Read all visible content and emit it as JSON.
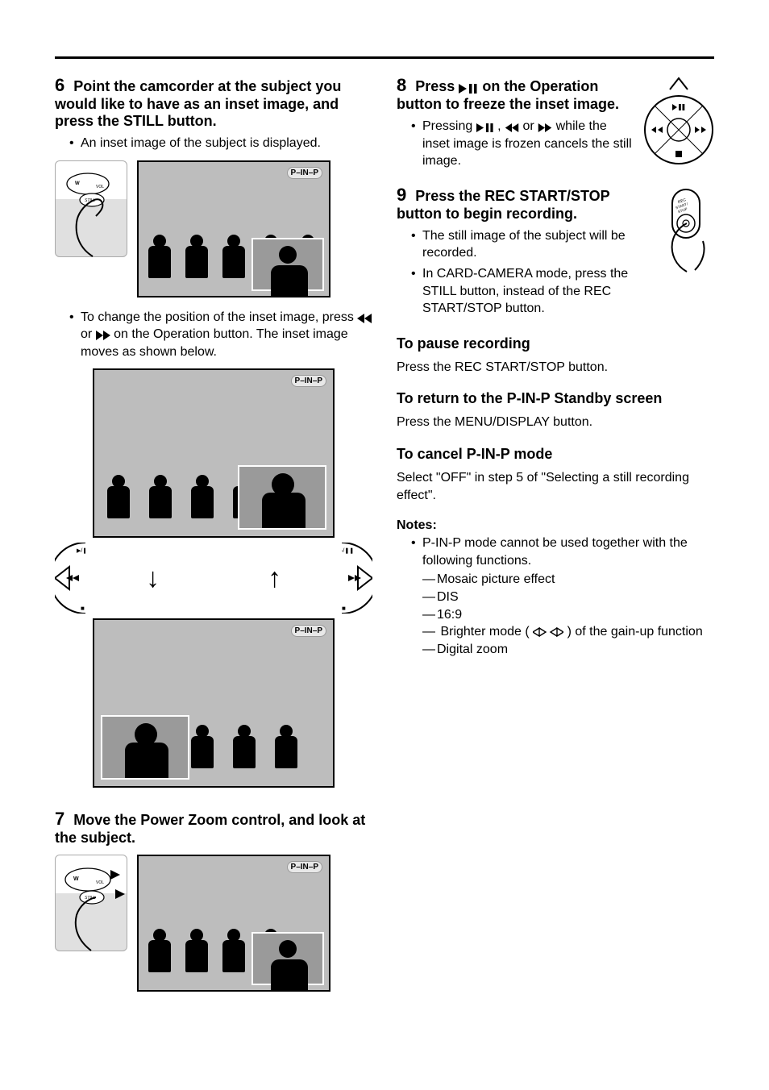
{
  "icons": {
    "play_pause": "▶/❚❚",
    "rew": "◀◀",
    "ff": "▶▶",
    "gain_brighter": "brighter-mode-icon"
  },
  "left": {
    "step6": {
      "num": "6",
      "title": "Point the camcorder at the subject you would like to have as an inset image, and press the STILL button.",
      "bullet1": "An inset image of the subject is displayed.",
      "bullet2_pre": "To change the position of the inset image, press ",
      "bullet2_mid": " or ",
      "bullet2_post": " on the Operation button. The inset image moves as shown below.",
      "badge": "P–IN–P"
    },
    "step7": {
      "num": "7",
      "title": "Move the Power Zoom control, and look at the subject."
    }
  },
  "right": {
    "step8": {
      "num": "8",
      "title_pre": "Press ",
      "title_post": " on the Operation button to freeze the inset image.",
      "bullet1_pre": "Pressing ",
      "bullet1_mid1": ", ",
      "bullet1_mid2": " or ",
      "bullet1_post": " while the inset image is frozen cancels the still image."
    },
    "step9": {
      "num": "9",
      "title": "Press the REC START/STOP button to begin recording.",
      "bullet1": "The still image of the subject will be recorded.",
      "bullet2": "In CARD-CAMERA mode, press the STILL button, instead of the REC START/STOP button."
    },
    "pause": {
      "title": "To pause recording",
      "text": "Press the REC START/STOP button."
    },
    "return": {
      "title": "To return to the P-IN-P Standby screen",
      "text": "Press the MENU/DISPLAY button."
    },
    "cancel": {
      "title": "To cancel P-IN-P mode",
      "text": "Select \"OFF\" in step 5 of \"Selecting a still recording effect\"."
    },
    "notes": {
      "title": "Notes:",
      "lead": "P-IN-P mode cannot be used together with the following functions.",
      "items": [
        "Mosaic picture effect",
        "DIS",
        "16:9",
        "Brighter mode (        ) of the gain-up function",
        "Digital zoom"
      ]
    }
  }
}
